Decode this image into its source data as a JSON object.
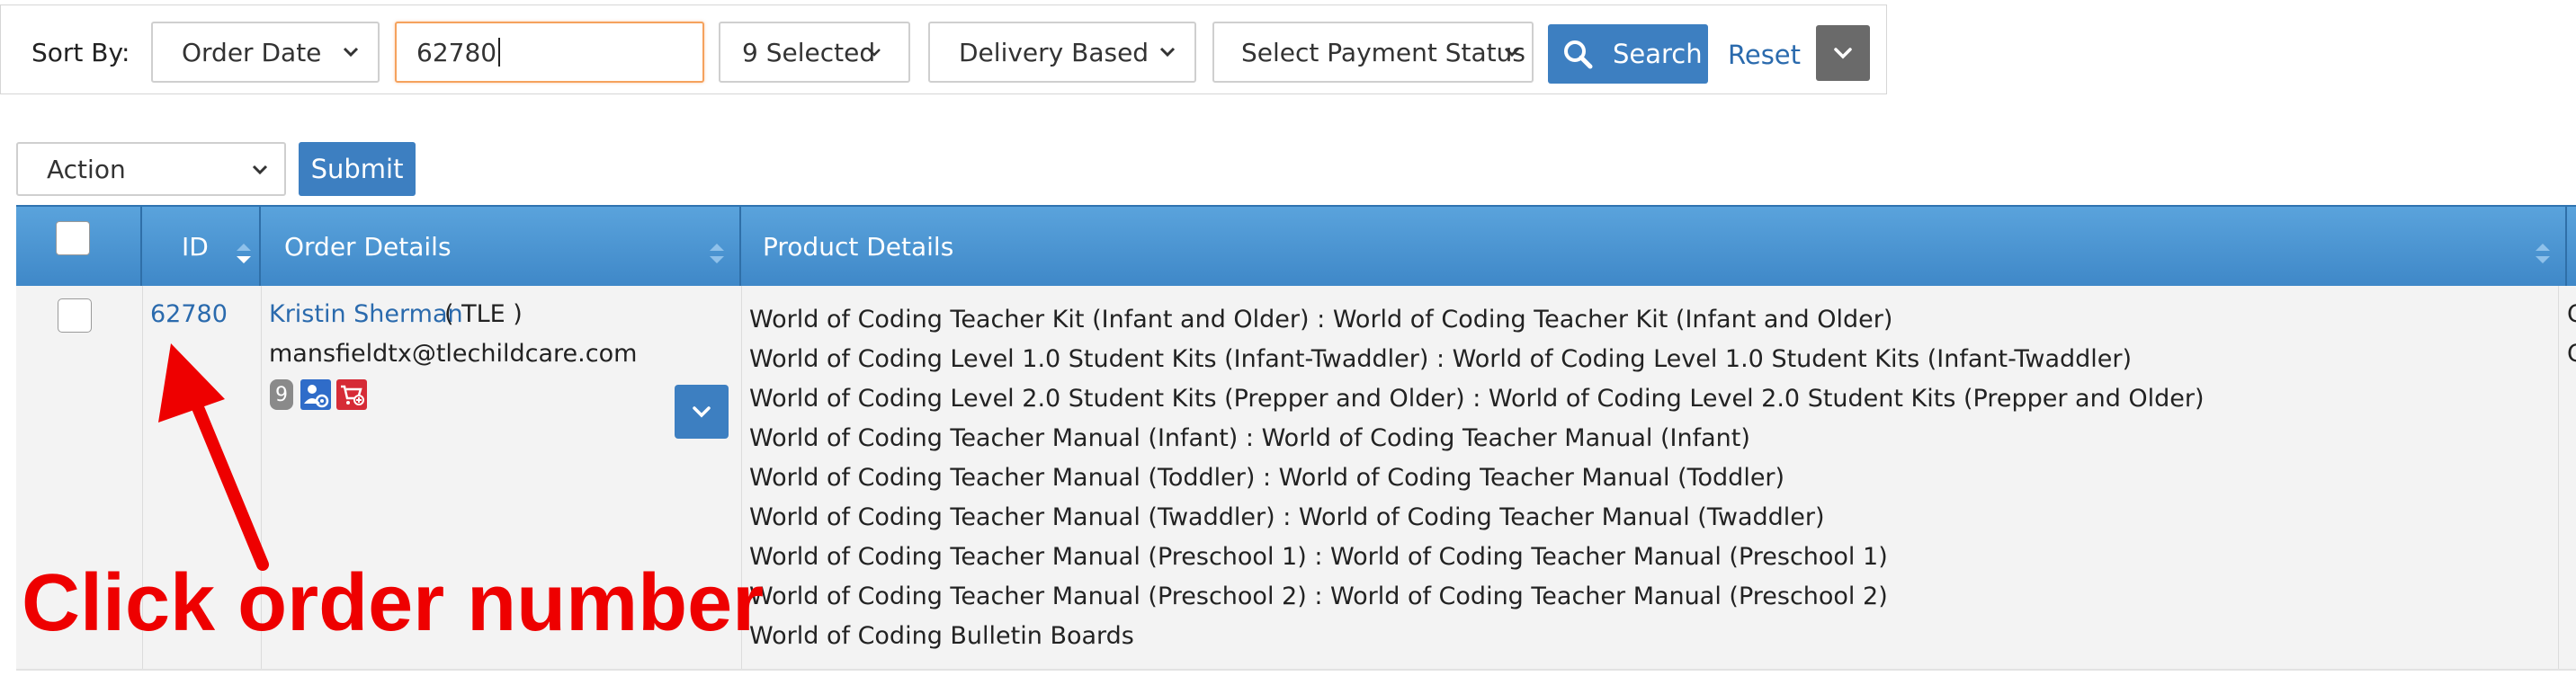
{
  "filters": {
    "sort_label": "Sort By:",
    "sort_by_value": "Order Date",
    "search_value": "62780",
    "status_value": "9 Selected",
    "delivery_value": "Delivery Based",
    "payment_value": "Select Payment Status",
    "search_button": "Search",
    "reset_link": "Reset"
  },
  "bulk": {
    "action_value": "Action",
    "submit_button": "Submit"
  },
  "table": {
    "headers": {
      "id": "ID",
      "order_details": "Order Details",
      "product_details": "Product Details"
    },
    "row": {
      "order_id": "62780",
      "customer_name": "Kristin Sherman",
      "customer_code": "( TLE )",
      "email": "mansfieldtx@tlechildcare.com",
      "badge_count": "9",
      "products": [
        "World of Coding Teacher Kit (Infant and Older) : World of Coding Teacher Kit (Infant and Older)",
        "World of Coding Level 1.0 Student Kits (Infant-Twaddler) : World of Coding Level 1.0 Student Kits (Infant-Twaddler)",
        "World of Coding Level 2.0 Student Kits (Prepper and Older) : World of Coding Level 2.0 Student Kits (Prepper and Older)",
        "World of Coding Teacher Manual (Infant) : World of Coding Teacher Manual (Infant)",
        "World of Coding Teacher Manual (Toddler) : World of Coding Teacher Manual (Toddler)",
        "World of Coding Teacher Manual (Twaddler) : World of Coding Teacher Manual (Twaddler)",
        "World of Coding Teacher Manual (Preschool 1) : World of Coding Teacher Manual (Preschool 1)",
        "World of Coding Teacher Manual (Preschool 2) : World of Coding Teacher Manual (Preschool 2)",
        "World of Coding Bulletin Boards"
      ],
      "edge_fragment_1": "C",
      "edge_fragment_2": "C"
    }
  },
  "annotation": {
    "text": "Click order number"
  },
  "colors": {
    "accent_blue": "#3d7fc1",
    "link_blue": "#2a6aad",
    "annotation_red": "#ee0000",
    "focus_orange": "#f5a25d"
  },
  "icons": [
    "search-icon",
    "chevron-down-icon",
    "sort-icon",
    "user-settings-icon",
    "cart-icon",
    "arrow-annotation"
  ]
}
